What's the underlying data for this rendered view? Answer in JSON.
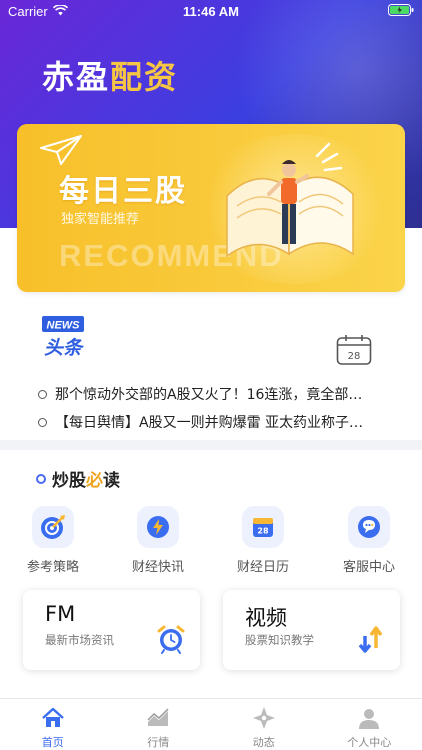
{
  "status_bar": {
    "carrier": "Carrier",
    "time": "11:46 AM"
  },
  "brand": {
    "part1": "赤盈",
    "part2": "配资"
  },
  "banner": {
    "title": "每日三股",
    "subtitle": "独家智能推荐",
    "watermark": "RECOMMEND"
  },
  "news": {
    "logo_top": "NEWS",
    "logo_bottom": "头条",
    "calendar_day": "28",
    "items": [
      "那个惊动外交部的A股又火了！16连涨，竟全部…",
      "【每日舆情】A股又一则并购爆雷 亚太药业称子…"
    ]
  },
  "section": {
    "title_prefix": "炒股",
    "title_highlight": "必",
    "title_suffix": "读"
  },
  "features": [
    {
      "label": "参考策略",
      "icon": "target-icon"
    },
    {
      "label": "财经快讯",
      "icon": "lightning-icon"
    },
    {
      "label": "财经日历",
      "icon": "calendar-icon",
      "badge": "28"
    },
    {
      "label": "客服中心",
      "icon": "chat-icon"
    }
  ],
  "cards": [
    {
      "title": "FM",
      "subtitle": "最新市场资讯",
      "icon": "alarm-clock-icon"
    },
    {
      "title": "视频",
      "subtitle": "股票知识教学",
      "icon": "up-down-arrows-icon"
    }
  ],
  "tabs": [
    {
      "label": "首页",
      "icon": "home-icon",
      "active": true
    },
    {
      "label": "行情",
      "icon": "chart-icon",
      "active": false
    },
    {
      "label": "动态",
      "icon": "compass-icon",
      "active": false
    },
    {
      "label": "个人中心",
      "icon": "person-icon",
      "active": false
    }
  ],
  "colors": {
    "accent": "#3b6df0",
    "gold": "#f0a521",
    "banner": "#f9c93a"
  }
}
